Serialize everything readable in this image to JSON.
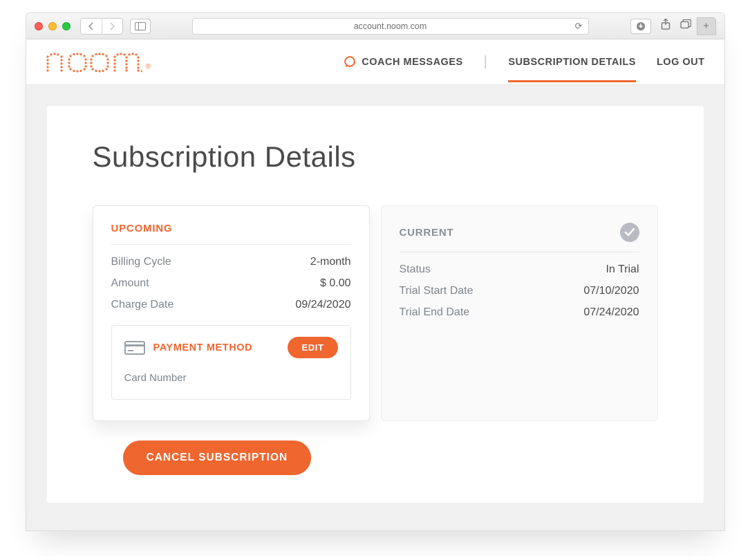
{
  "browser": {
    "url": "account.noom.com"
  },
  "header": {
    "brand": "noom",
    "nav": {
      "coach": "COACH MESSAGES",
      "subscription": "SUBSCRIPTION DETAILS",
      "logout": "LOG OUT"
    }
  },
  "page_title": "Subscription Details",
  "upcoming": {
    "title": "UPCOMING",
    "billing_cycle_label": "Billing Cycle",
    "billing_cycle_value": "2-month",
    "amount_label": "Amount",
    "amount_value": "$ 0.00",
    "charge_date_label": "Charge Date",
    "charge_date_value": "09/24/2020",
    "payment_method_label": "PAYMENT METHOD",
    "edit_label": "EDIT",
    "card_number_label": "Card Number"
  },
  "current": {
    "title": "CURRENT",
    "status_label": "Status",
    "status_value": "In Trial",
    "start_label": "Trial Start Date",
    "start_value": "07/10/2020",
    "end_label": "Trial End Date",
    "end_value": "07/24/2020"
  },
  "cancel_label": "CANCEL SUBSCRIPTION"
}
